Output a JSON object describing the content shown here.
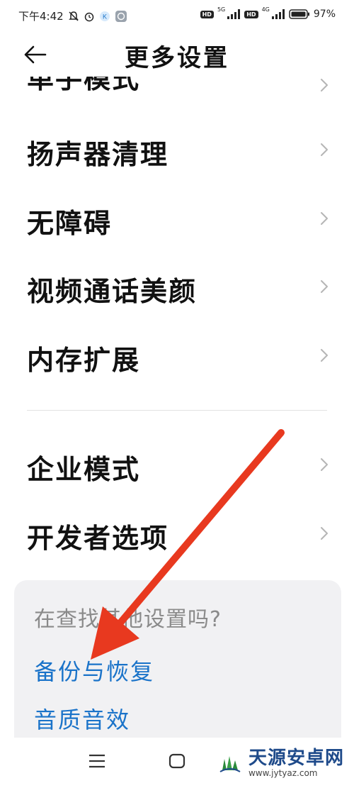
{
  "status_bar": {
    "time": "下午4:42",
    "network1": "5G",
    "network2": "4G",
    "hd": "HD",
    "battery": "97%"
  },
  "header": {
    "title": "更多设置",
    "back_icon": "back-arrow-icon"
  },
  "settings_items": [
    {
      "label": "单手模式"
    },
    {
      "label": "扬声器清理"
    },
    {
      "label": "无障碍"
    },
    {
      "label": "视频通话美颜"
    },
    {
      "label": "内存扩展"
    },
    {
      "label": "企业模式"
    },
    {
      "label": "开发者选项"
    }
  ],
  "suggestion_card": {
    "title": "在查找其他设置吗?",
    "links": [
      {
        "label": "备份与恢复"
      },
      {
        "label": "音质音效"
      }
    ]
  },
  "colors": {
    "accent_link": "#1a73c9",
    "annotation_arrow": "#e8391f"
  },
  "watermark": {
    "name": "天源安卓网",
    "url": "www.jytyaz.com"
  }
}
